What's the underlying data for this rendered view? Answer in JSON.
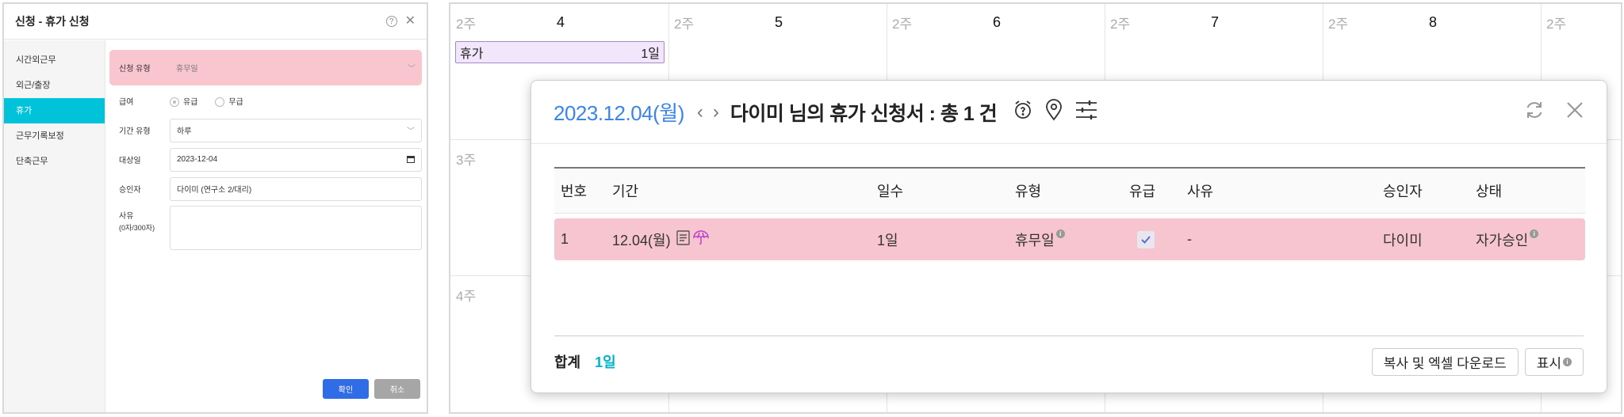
{
  "dialog": {
    "title": "신청 - 휴가 신청",
    "help_glyph": "?",
    "close_glyph": "✕",
    "sidebar": [
      {
        "label": "시간외근무"
      },
      {
        "label": "외근/출장"
      },
      {
        "label": "휴가",
        "active": true
      },
      {
        "label": "근무기록보정"
      },
      {
        "label": "단축근무"
      }
    ],
    "form": {
      "type_label": "신청 유형",
      "type_value": "휴무일",
      "pay_label": "급여",
      "pay_paid": "유급",
      "pay_unpaid": "무급",
      "period_label": "기간 유형",
      "period_value": "하루",
      "date_label": "대상일",
      "date_value": "2023-12-04",
      "approver_label": "승인자",
      "approver_value": "다이미 (연구소 2/대리)",
      "reason_label": "사유",
      "reason_count": "(0자/300자)",
      "reason_value": ""
    },
    "ok_label": "확인",
    "cancel_label": "취소"
  },
  "calendar": {
    "days": [
      {
        "week": "2주",
        "day": "4"
      },
      {
        "week": "2주",
        "day": "5"
      },
      {
        "week": "2주",
        "day": "6"
      },
      {
        "week": "2주",
        "day": "7"
      },
      {
        "week": "2주",
        "day": "8"
      },
      {
        "week": "2주",
        "day": ""
      }
    ],
    "rows": [
      "3주",
      "4주"
    ],
    "event": {
      "label": "휴가",
      "count": "1일"
    }
  },
  "popup": {
    "date": "2023.12.04(월)",
    "title": "다이미 님의 휴가 신청서 : 총 1 건",
    "columns": [
      "번호",
      "기간",
      "일수",
      "유형",
      "유급",
      "사유",
      "승인자",
      "상태"
    ],
    "rows": [
      {
        "no": "1",
        "period": "12.04(월)",
        "days": "1일",
        "type": "휴무일",
        "paid": true,
        "reason": "-",
        "approver": "다이미",
        "status": "자가승인"
      }
    ],
    "total_label": "합계",
    "total_value": "1일",
    "download_label": "복사 및 엑셀 다운로드",
    "display_label": "표시",
    "colors": {
      "accent": "#3a86e8",
      "row_highlight": "#f7c5d0",
      "teal": "#00c3d9"
    }
  }
}
